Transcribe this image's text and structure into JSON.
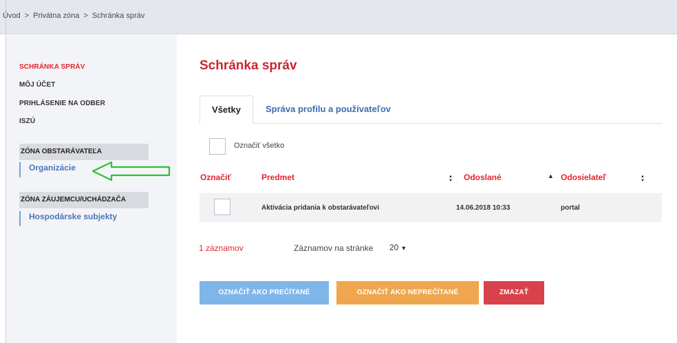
{
  "breadcrumb": {
    "items": [
      "Úvod",
      "Privátna zóna",
      "Schránka správ"
    ],
    "separator": ">"
  },
  "sidebar": {
    "links": [
      "SCHRÁNKA SPRÁV",
      "MÔJ ÚČET",
      "PRIHLÁSENIE NA ODBER",
      "ISZÚ"
    ],
    "groups": [
      {
        "title": "ZÓNA OBSTARÁVATEĽA",
        "items": [
          "Organizácie"
        ]
      },
      {
        "title": "ZÓNA ZÁUJEMCU/UCHÁDZAČA",
        "items": [
          "Hospodárske subjekty"
        ]
      }
    ]
  },
  "main": {
    "title": "Schránka správ",
    "tabs": [
      "Všetky",
      "Správa profilu a používateľov"
    ],
    "select_all_label": "Označiť všetko",
    "table": {
      "headers": [
        "Označiť",
        "Predmet",
        "Odoslané",
        "Odosielateľ"
      ],
      "rows": [
        {
          "subject": "Aktivácia pridania k obstarávateľovi",
          "sent": "14.06.2018 10:33",
          "sender": "portal"
        }
      ]
    },
    "records_count": "1 záznamov",
    "per_page_label": "Záznamov na stránke",
    "per_page_value": "20",
    "buttons": {
      "mark_read": "OZNAČIŤ AKO PREČÍTANÉ",
      "mark_unread": "OZNAČIŤ AKO NEPREČÍTANÉ",
      "delete": "ZMAZAŤ"
    }
  },
  "colors": {
    "accent_red": "#e0262e",
    "link_blue": "#3b6fb0",
    "btn_blue": "#7eb6ea",
    "btn_orange": "#eea74e",
    "btn_red": "#d9424a",
    "arrow_green": "#2fbf2f"
  },
  "icons": {
    "sort": "sort-icon",
    "arrow": "green-arrow-annotation",
    "chevron": "chevron-down-icon"
  }
}
